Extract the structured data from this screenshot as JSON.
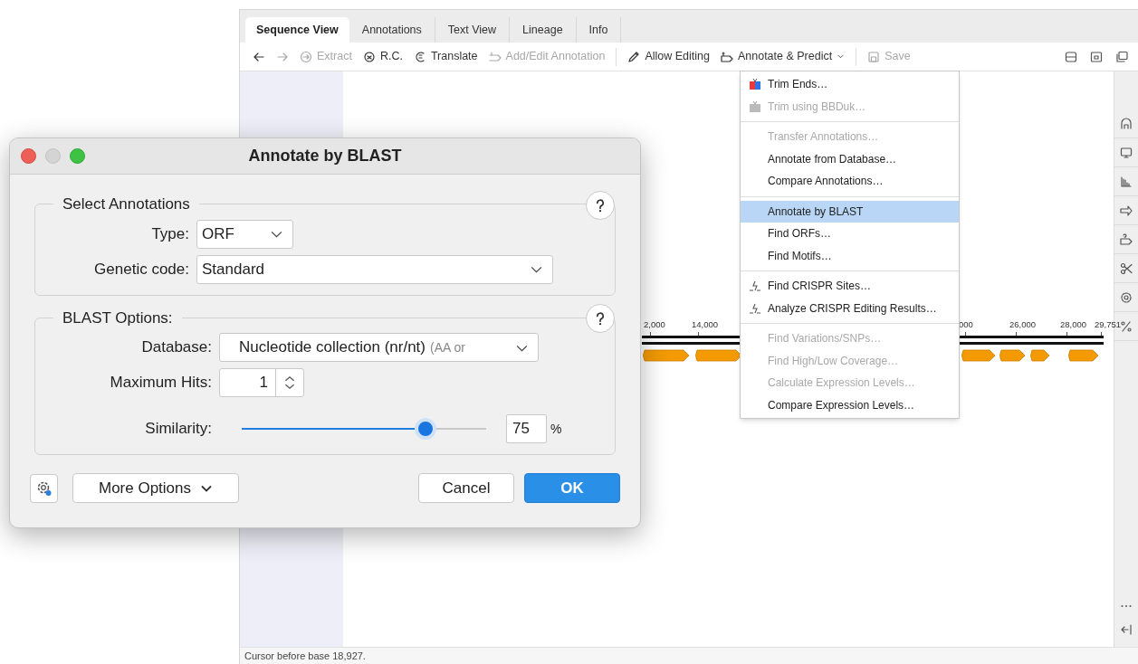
{
  "tabs": [
    {
      "label": "Sequence View",
      "selected": true
    },
    {
      "label": "Annotations",
      "selected": false
    },
    {
      "label": "Text View",
      "selected": false
    },
    {
      "label": "Lineage",
      "selected": false
    },
    {
      "label": "Info",
      "selected": false
    }
  ],
  "toolbar": [
    {
      "kind": "back",
      "disabled": false
    },
    {
      "kind": "forward",
      "disabled": true
    },
    {
      "kind": "extract",
      "label": "Extract",
      "disabled": true
    },
    {
      "kind": "rc",
      "label": "R.C.",
      "disabled": false
    },
    {
      "kind": "translate",
      "label": "Translate",
      "disabled": false
    },
    {
      "kind": "annotation",
      "label": "Add/Edit Annotation",
      "disabled": true
    },
    {
      "kind": "separator"
    },
    {
      "kind": "edit",
      "label": "Allow Editing",
      "disabled": false
    },
    {
      "kind": "predict",
      "label": "Annotate & Predict",
      "disabled": false
    },
    {
      "kind": "separator"
    },
    {
      "kind": "save",
      "label": "Save",
      "disabled": true
    }
  ],
  "track": {
    "ticks": [
      "2,000",
      "14,000",
      "000",
      "26,000",
      "28,000",
      "29,751"
    ]
  },
  "status_bar": "Cursor before base 18,927.",
  "menu": {
    "groups": [
      [
        {
          "label": "Trim Ends…",
          "kind": "trim",
          "disabled": false,
          "selected": false
        },
        {
          "label": "Trim using BBDuk…",
          "kind": "trim",
          "disabled": true,
          "selected": false
        }
      ],
      [
        {
          "label": "Transfer Annotations…",
          "kind": "plain",
          "disabled": true,
          "selected": false
        },
        {
          "label": "Annotate from Database…",
          "kind": "plain",
          "disabled": false,
          "selected": false
        },
        {
          "label": "Compare Annotations…",
          "kind": "plain",
          "disabled": false,
          "selected": false
        }
      ],
      [
        {
          "label": "Annotate by BLAST",
          "kind": "plain",
          "disabled": false,
          "selected": true
        },
        {
          "label": "Find ORFs…",
          "kind": "plain",
          "disabled": false,
          "selected": false
        },
        {
          "label": "Find Motifs…",
          "kind": "plain",
          "disabled": false,
          "selected": false
        }
      ],
      [
        {
          "label": "Find CRISPR Sites…",
          "kind": "crispr",
          "disabled": false,
          "selected": false
        },
        {
          "label": "Analyze CRISPR Editing Results…",
          "kind": "crispr",
          "disabled": false,
          "selected": false
        }
      ],
      [
        {
          "label": "Find Variations/SNPs…",
          "kind": "plain",
          "disabled": true,
          "selected": false
        },
        {
          "label": "Find High/Low Coverage…",
          "kind": "plain",
          "disabled": true,
          "selected": false
        },
        {
          "label": "Calculate Expression Levels…",
          "kind": "plain",
          "disabled": true,
          "selected": false
        },
        {
          "label": "Compare Expression Levels…",
          "kind": "plain",
          "disabled": false,
          "selected": false
        }
      ]
    ]
  },
  "dialog": {
    "title": "Annotate by BLAST",
    "sections": [
      {
        "title": "Select Annotations",
        "fields": [
          {
            "kind": "dropdown",
            "label": "Type:",
            "value": "ORF"
          },
          {
            "kind": "dropdown",
            "label": "Genetic code:",
            "value": "Standard"
          }
        ]
      },
      {
        "title": "BLAST Options:",
        "fields": [
          {
            "kind": "dropdown",
            "label": "Database:",
            "value": "Nucleotide collection (nr/nt)",
            "hint": "(AA or"
          },
          {
            "kind": "spinner",
            "label": "Maximum Hits:",
            "value": "1"
          },
          {
            "kind": "slider",
            "label": "Similarity:",
            "level": 0.75,
            "value": "75",
            "unit": "%"
          }
        ]
      }
    ],
    "more_options": "More Options",
    "cancel": "Cancel",
    "ok": "OK"
  }
}
